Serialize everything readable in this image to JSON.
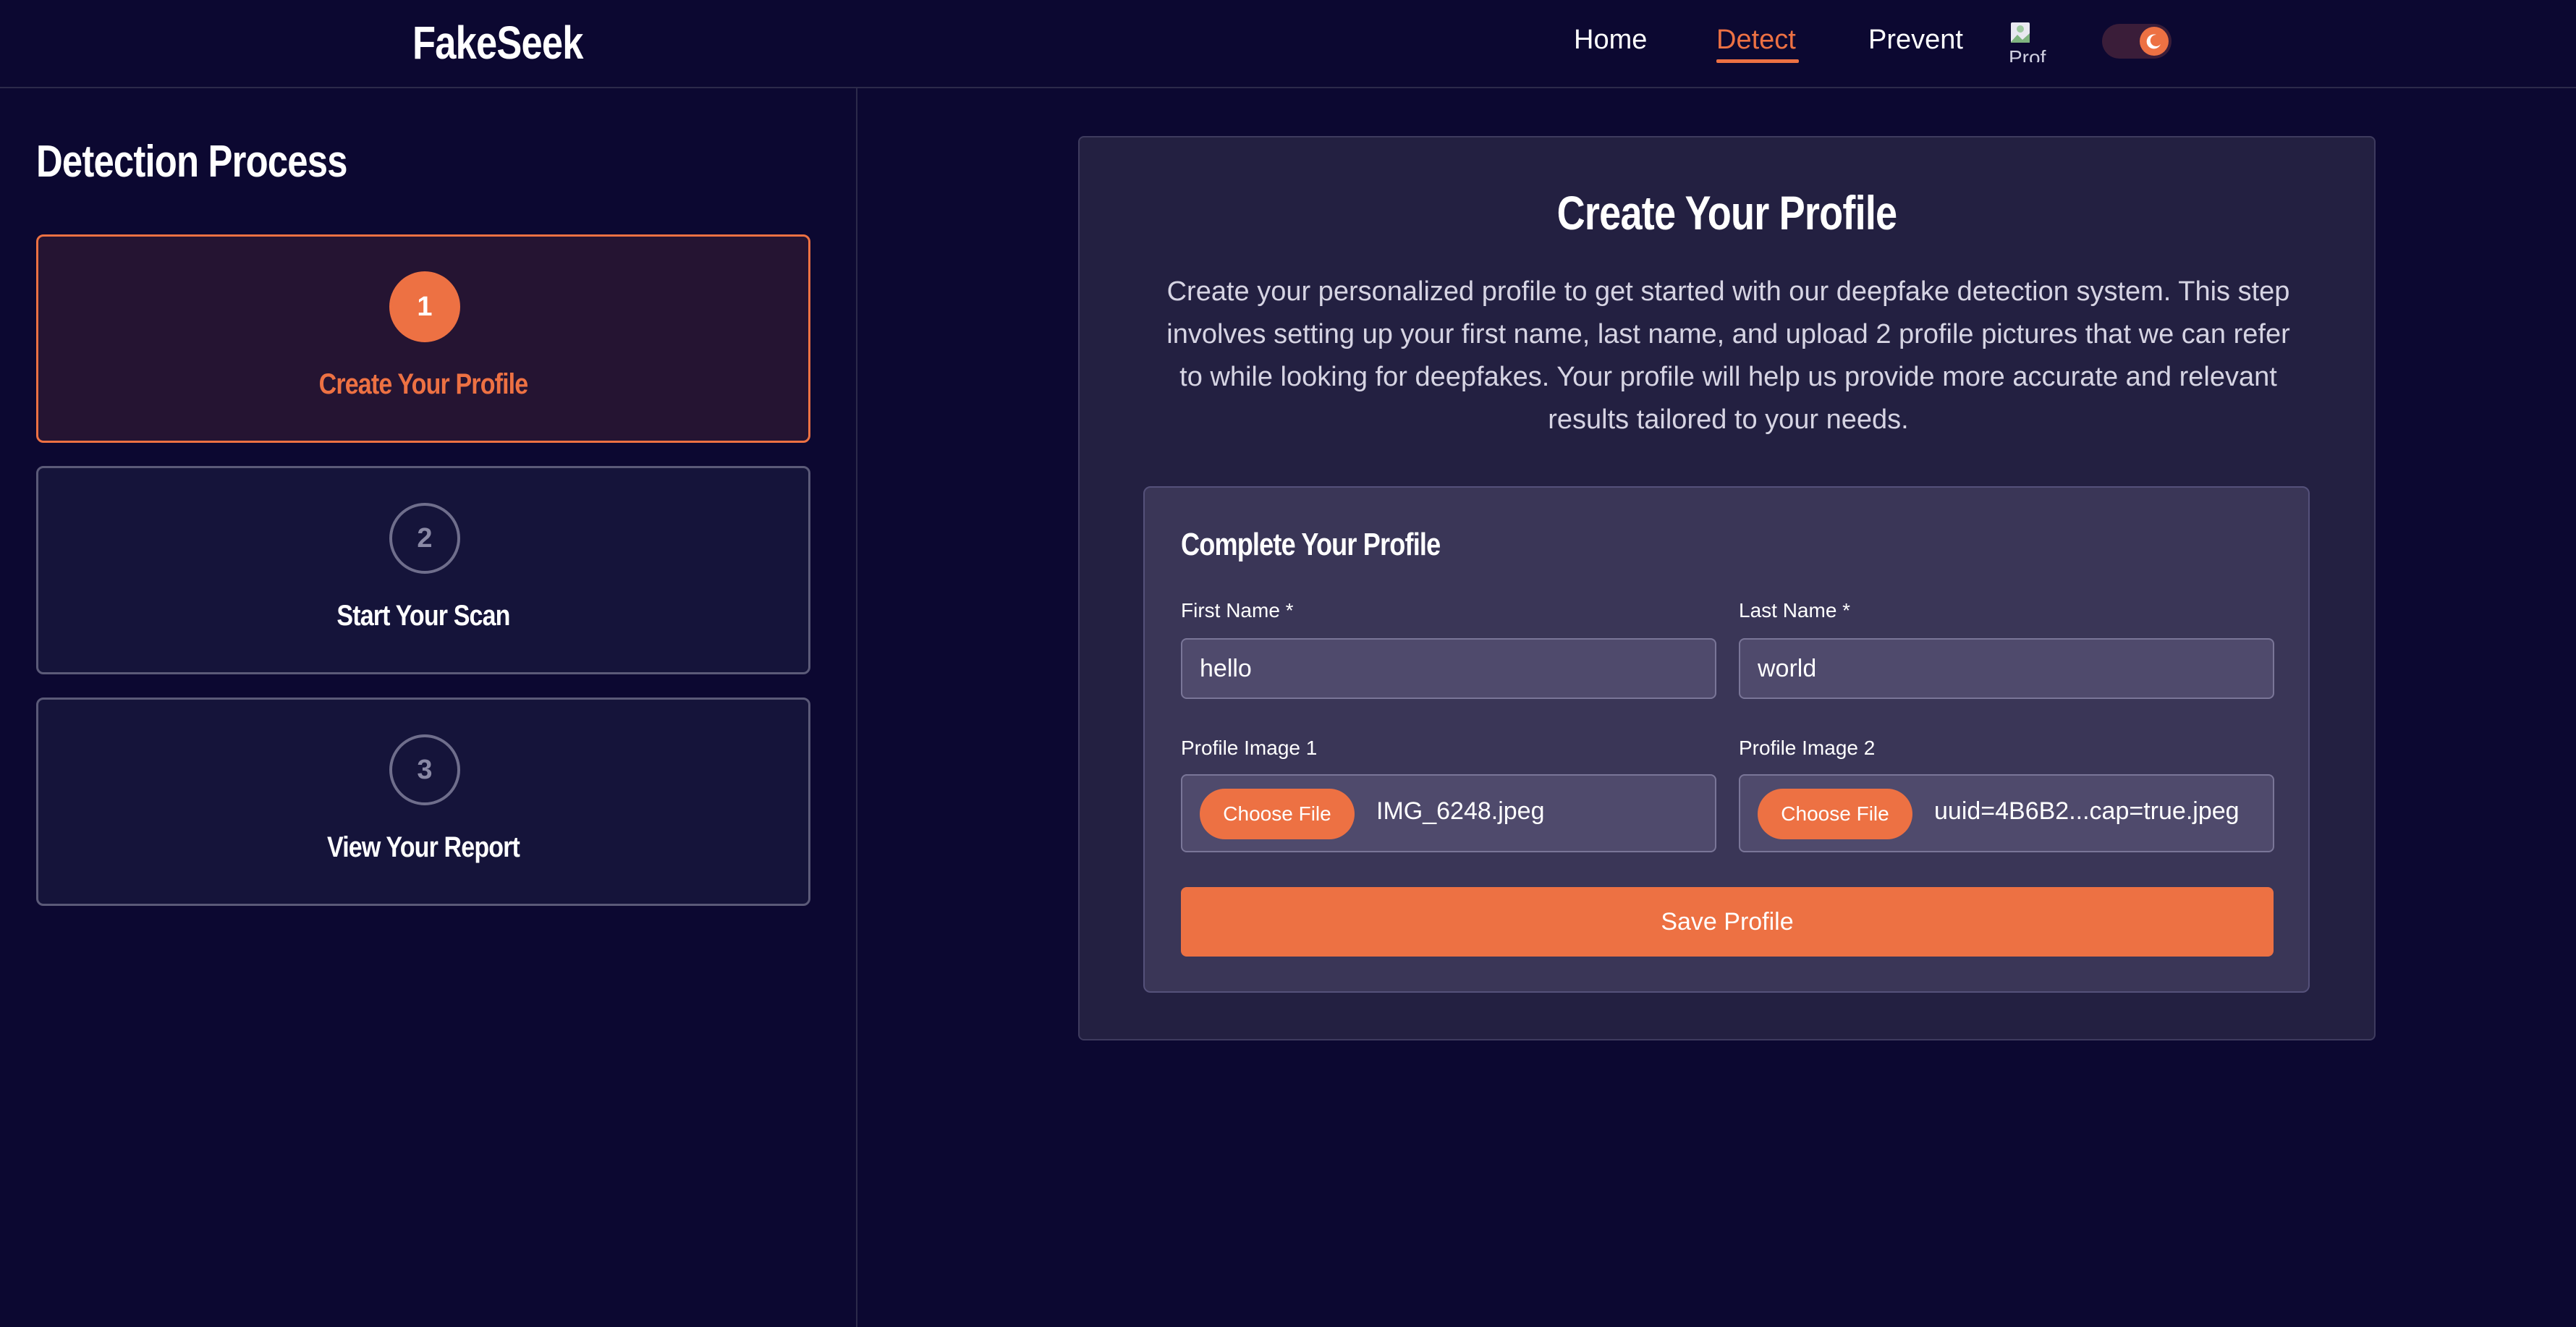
{
  "app": {
    "brand": "FakeSeek"
  },
  "nav": {
    "home": "Home",
    "detect": "Detect",
    "prevent": "Prevent",
    "avatar_alt": "Prof",
    "active": "Detect",
    "theme_toggle": "dark-mode-toggle"
  },
  "sidebar": {
    "title": "Detection Process",
    "steps": [
      {
        "number": "1",
        "label": "Create Your Profile",
        "active": true
      },
      {
        "number": "2",
        "label": "Start Your Scan",
        "active": false
      },
      {
        "number": "3",
        "label": "View Your Report",
        "active": false
      }
    ]
  },
  "main": {
    "title": "Create Your Profile",
    "description": "Create your personalized profile to get started with our deepfake detection system. This step involves setting up your first name, last name, and upload 2 profile pictures that we can refer to while looking for deepfakes. Your profile will help us provide more accurate and relevant results tailored to your needs.",
    "form": {
      "title": "Complete Your Profile",
      "first_name_label": "First Name *",
      "first_name_value": "hello",
      "last_name_label": "Last Name *",
      "last_name_value": "world",
      "image1_label": "Profile Image 1",
      "image1_button": "Choose File",
      "image1_file": "IMG_6248.jpeg",
      "image2_label": "Profile Image 2",
      "image2_button": "Choose File",
      "image2_file": "uuid=4B6B2...cap=true.jpeg",
      "save_button": "Save Profile"
    }
  },
  "colors": {
    "background": "#0c0831",
    "accent": "#ed7143",
    "card": "#232041",
    "inner_card": "#3a3657"
  }
}
